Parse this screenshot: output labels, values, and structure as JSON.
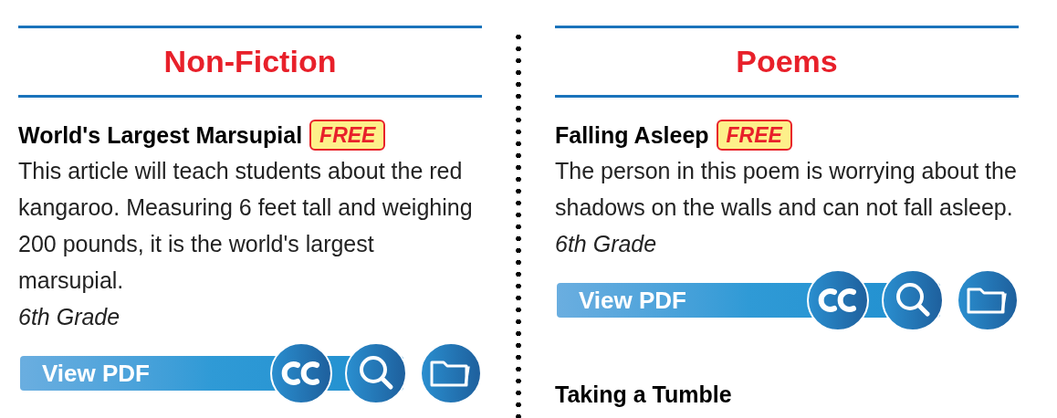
{
  "columns": [
    {
      "heading": "Non-Fiction",
      "items": [
        {
          "title": "World's Largest Marsupial",
          "badge": "FREE",
          "description": "This article will teach students about the red kangaroo. Measuring 6 feet tall and weighing 200 pounds, it is the world's largest marsupial.",
          "grade": "6th Grade",
          "button": "View PDF"
        }
      ]
    },
    {
      "heading": "Poems",
      "items": [
        {
          "title": "Falling Asleep",
          "badge": "FREE",
          "description": "The person in this poem is worrying about the shadows on the walls and can not fall asleep.",
          "grade": "6th Grade",
          "button": "View PDF"
        },
        {
          "title": "Taking a Tumble"
        }
      ]
    }
  ]
}
